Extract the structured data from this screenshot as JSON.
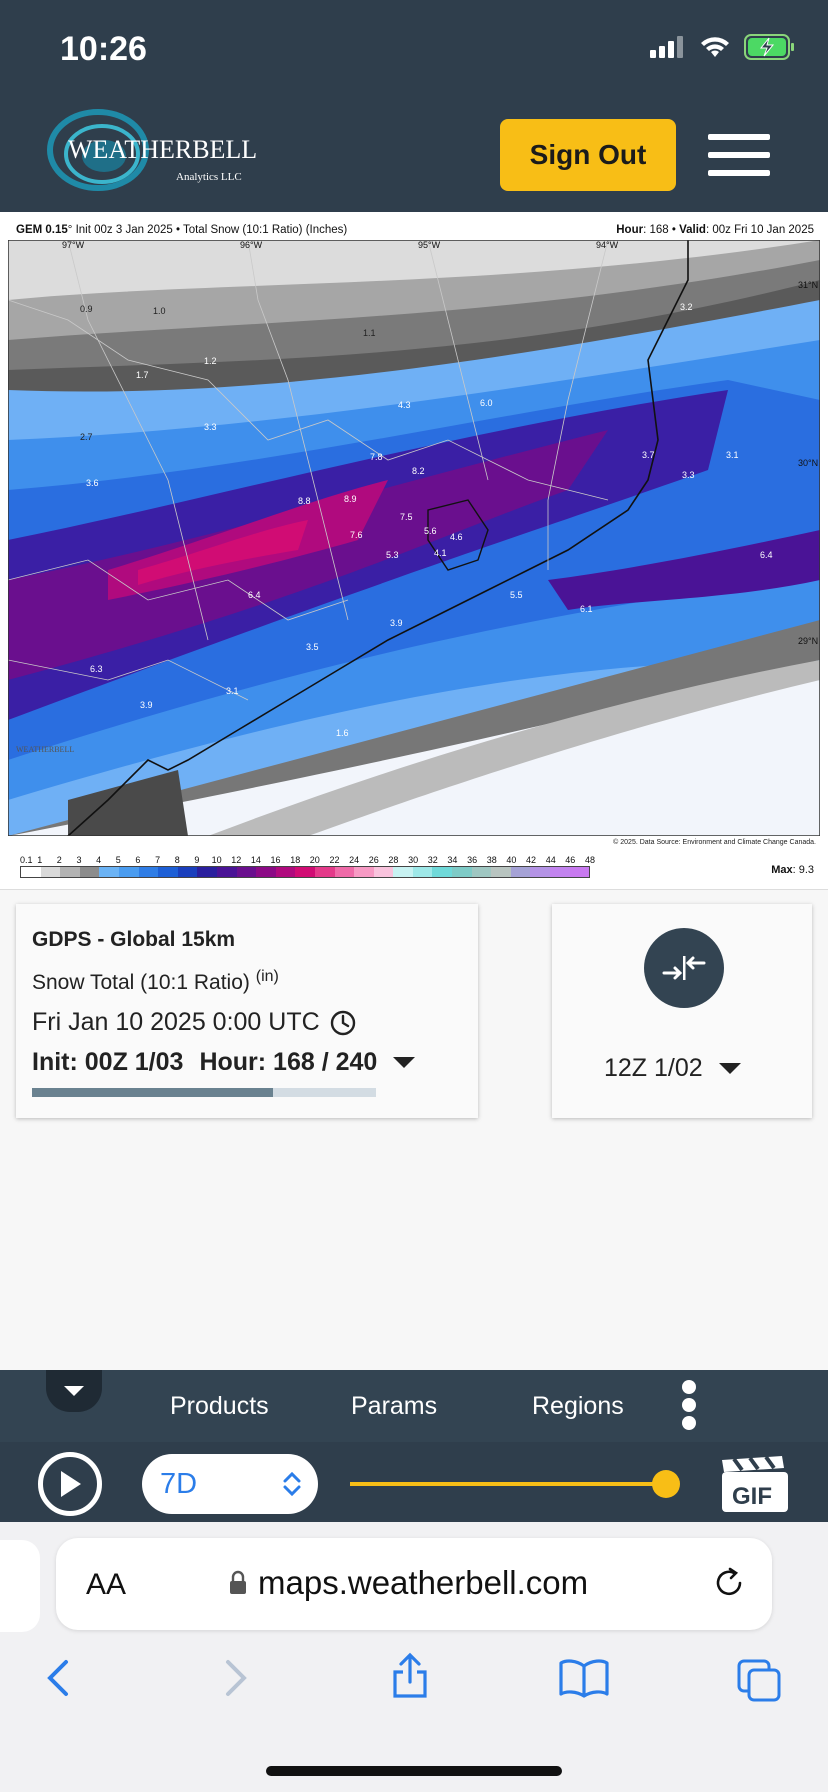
{
  "status_bar": {
    "time": "10:26"
  },
  "header": {
    "logo_text": "WEATHERBELL",
    "logo_sub": "Analytics LLC",
    "sign_out_label": "Sign Out"
  },
  "map": {
    "title_model": "GEM 0.15",
    "title_rest": "° Init 00z 3 Jan 2025 • Total Snow (10:1 Ratio) (Inches)",
    "hour_label": "Hour",
    "hour_value": ": 168 • ",
    "valid_label": "Valid",
    "valid_value": ": 00z Fri 10 Jan 2025",
    "lon_labels": [
      "97°W",
      "96°W",
      "95°W",
      "94°W"
    ],
    "lat_labels": [
      "31°N",
      "30°N",
      "29°N"
    ],
    "station_values": [
      "0.9",
      "1.0",
      "1.1",
      "1.2",
      "1.7",
      "3.2",
      "2.7",
      "3.3",
      "4.3",
      "6.0",
      "3.7",
      "3.1",
      "3.6",
      "7.8",
      "8.2",
      "3.3",
      "8.8",
      "8.9",
      "7.5",
      "5.6",
      "4.6",
      "7.6",
      "5.3",
      "4.1",
      "6.4",
      "6.4",
      "5.5",
      "6.1",
      "3.9",
      "3.5",
      "6.3",
      "3.1",
      "3.9",
      "1.6"
    ],
    "credit": "© 2025. Data Source: Environment and Climate Change Canada.",
    "legend_ticks": [
      "0.1",
      "1",
      "2",
      "3",
      "4",
      "5",
      "6",
      "7",
      "8",
      "9",
      "10",
      "12",
      "14",
      "16",
      "18",
      "20",
      "22",
      "24",
      "26",
      "28",
      "30",
      "32",
      "34",
      "36",
      "38",
      "40",
      "42",
      "44",
      "46",
      "48"
    ],
    "legend_colors": [
      "#ffffff",
      "#d9d9d9",
      "#b3b3b3",
      "#8c8c8c",
      "#6bb3f5",
      "#4a9cf0",
      "#2f7de6",
      "#1d5fd6",
      "#1a3fbd",
      "#2a1f9e",
      "#4a1396",
      "#6a0f8e",
      "#8c0a86",
      "#b00a7e",
      "#d10c74",
      "#e43a8a",
      "#ef6aa8",
      "#f79ac4",
      "#f9c3dd",
      "#c8f2f2",
      "#9ee8e8",
      "#6fd9d9",
      "#7ecbc7",
      "#9fc7c2",
      "#b8c4c0",
      "#a5a2d6",
      "#b493e6",
      "#c283ef",
      "#c879f0"
    ],
    "max_label": "Max",
    "max_value": ": 9.3"
  },
  "info_card": {
    "model": "GDPS - Global 15km",
    "param": "Snow Total (10:1 Ratio)",
    "unit": "(in)",
    "valid_time": "Fri Jan 10 2025 0:00 UTC",
    "init_run": "Init: 00Z 1/03",
    "hour": "Hour: 168 / 240",
    "progress": 0.7
  },
  "compare_card": {
    "run": "12Z 1/02"
  },
  "toolbar": {
    "products": "Products",
    "params": "Params",
    "regions": "Regions"
  },
  "playbar": {
    "range": "7D",
    "gif_label": "GIF",
    "slider_position": 1.0
  },
  "safari": {
    "aa": "AA",
    "url": "maps.weatherbell.com"
  },
  "colors": {
    "header_bg": "#2f3e4c",
    "accent": "#f8be16",
    "link_blue": "#2b7de9"
  }
}
